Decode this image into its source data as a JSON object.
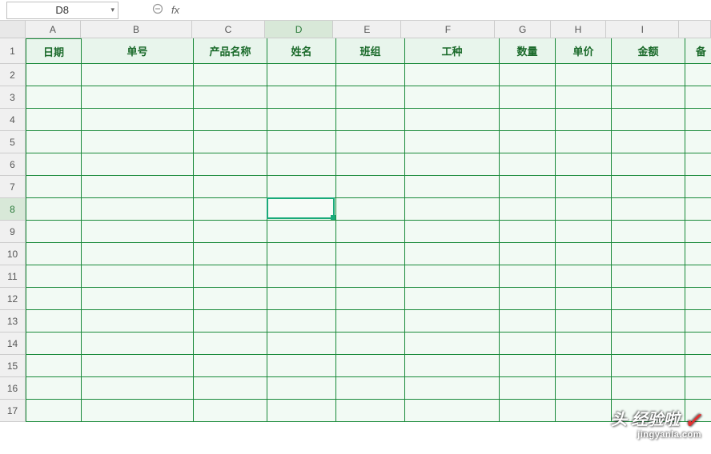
{
  "nameBox": {
    "value": "D8"
  },
  "formulaBar": {
    "cancel": "⊖",
    "fx": "fx",
    "value": ""
  },
  "columns": [
    {
      "id": "A",
      "label": "A",
      "widthClass": "wA"
    },
    {
      "id": "B",
      "label": "B",
      "widthClass": "wB"
    },
    {
      "id": "C",
      "label": "C",
      "widthClass": "wC"
    },
    {
      "id": "D",
      "label": "D",
      "widthClass": "wD",
      "active": true
    },
    {
      "id": "E",
      "label": "E",
      "widthClass": "wE"
    },
    {
      "id": "F",
      "label": "F",
      "widthClass": "wF"
    },
    {
      "id": "G",
      "label": "G",
      "widthClass": "wG"
    },
    {
      "id": "H",
      "label": "H",
      "widthClass": "wH"
    },
    {
      "id": "I",
      "label": "I",
      "widthClass": "wI"
    },
    {
      "id": "J",
      "label": "",
      "widthClass": "wJ"
    }
  ],
  "rowCount": 17,
  "activeRow": 8,
  "headers": {
    "A": "日期",
    "B": "单号",
    "C": "产品名称",
    "D": "姓名",
    "E": "班组",
    "F": "工种",
    "G": "数量",
    "H": "单价",
    "I": "金额",
    "J": "备"
  },
  "selection": {
    "col": "D",
    "row": 8
  },
  "watermark": {
    "prefix": "头",
    "main": "经验啦",
    "sub": "jingyanla.com"
  }
}
